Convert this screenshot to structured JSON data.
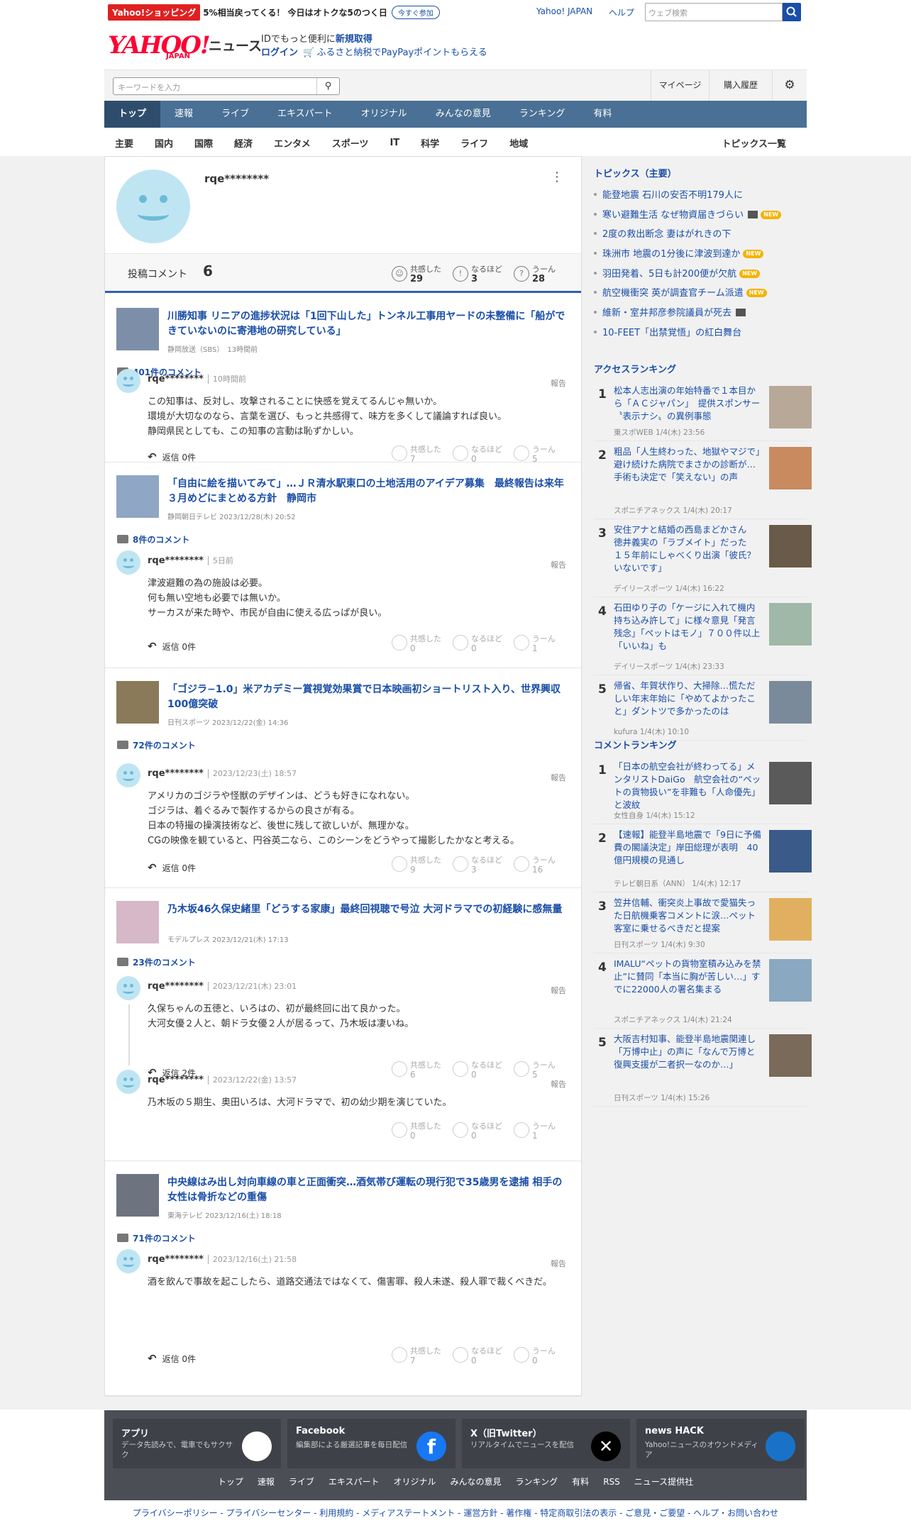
{
  "promo": {
    "shop": "Yahoo!ショッピング",
    "message": "5%相当戻ってくる！ 今日はオトクな5のつく日",
    "button": "今すぐ参加"
  },
  "topbar": {
    "yahoo_japan": "Yahoo! JAPAN",
    "help": "ヘルプ",
    "search_placeholder": "ウェブ検索"
  },
  "header": {
    "logo": "YAHOO!",
    "logo_sub": "JAPAN",
    "service": "ニュース",
    "id_msg": "IDでもっと便利に",
    "signup": "新規取得",
    "login": "ログイン",
    "furusato": "ふるさと納税でPayPayポイントもらえる"
  },
  "search": {
    "placeholder": "キーワードを入力",
    "mypage": "マイページ",
    "history": "購入履歴"
  },
  "nav": [
    "トップ",
    "速報",
    "ライブ",
    "エキスパート",
    "オリジナル",
    "みんなの意見",
    "ランキング",
    "有料"
  ],
  "subnav": [
    "主要",
    "国内",
    "国際",
    "経済",
    "エンタメ",
    "スポーツ",
    "IT",
    "科学",
    "ライフ",
    "地域"
  ],
  "subnav_all": "トピックス一覧",
  "profile": {
    "name": "rqe********",
    "posts_label": "投稿コメント",
    "posts": "6",
    "empathy_label": "共感した",
    "empathy": "29",
    "naruhodo_label": "なるほど",
    "naruhodo": "3",
    "uun_label": "うーん",
    "uun": "28"
  },
  "labels": {
    "report": "報告",
    "empathy": "共感した",
    "naruhodo": "なるほど",
    "uun": "うーん"
  },
  "articles": [
    {
      "title": "川勝知事 リニアの進捗状況は「1回下山した」トンネル工事用ヤードの未整備に「船ができていないのに寄港地の研究している」",
      "source": "静岡放送（SBS）　13時間前",
      "count": "401件のコメント",
      "comments": [
        {
          "user": "rqe********",
          "time": "10時間前",
          "text": [
            "この知事は、反対し、攻撃されることに快感を覚えてるんじゃ無いか。",
            "環境が大切なのなら、言葉を選び、もっと共感得て、味方を多くして議論すれば良い。",
            "静岡県民としても、この知事の言動は恥ずかしい。"
          ],
          "reply": "返信 0件",
          "e": "7",
          "n": "0",
          "u": "5"
        }
      ]
    },
    {
      "title": "「自由に絵を描いてみて」…ＪＲ清水駅東口の土地活用のアイデア募集　最終報告は来年３月めどにまとめる方針　静岡市",
      "source": "静岡朝日テレビ 2023/12/28(木) 20:52",
      "count": "8件のコメント",
      "comments": [
        {
          "user": "rqe********",
          "time": "5日前",
          "text": [
            "津波避難の為の施設は必要。",
            "何も無い空地も必要では無いか。",
            "サーカスが来た時や、市民が自由に使える広っぱが良い。"
          ],
          "reply": "返信 0件",
          "e": "0",
          "n": "0",
          "u": "1"
        }
      ]
    },
    {
      "title": "「ゴジラ−1.0」米アカデミー賞視覚効果賞で日本映画初ショートリスト入り、世界興収100億突破",
      "source": "日刊スポーツ 2023/12/22(金) 14:36",
      "count": "72件のコメント",
      "comments": [
        {
          "user": "rqe********",
          "time": "2023/12/23(土) 18:57",
          "text": [
            "アメリカのゴジラや怪獣のデザインは、どうも好きになれない。",
            "ゴジラは、着ぐるみで製作するからの良さが有る。",
            "日本の特撮の操演技術など、後世に残して欲しいが、無理かな。",
            "CGの映像を観ていると、円谷英二なら、このシーンをどうやって撮影したかなと考える。"
          ],
          "reply": "返信 0件",
          "e": "9",
          "n": "3",
          "u": "16"
        }
      ]
    },
    {
      "title": "乃木坂46久保史緒里「どうする家康」最終回視聴で号泣 大河ドラマでの初経験に感無量",
      "source": "モデルプレス 2023/12/21(木) 17:13",
      "count": "23件のコメント",
      "comments": [
        {
          "user": "rqe********",
          "time": "2023/12/21(木) 23:01",
          "text": [
            "久保ちゃんの五徳と、いろはの、初が最終回に出て良かった。",
            "大河女優２人と、朝ドラ女優２人が居るって、乃木坂は凄いね。"
          ],
          "reply": "返信 2件",
          "e": "6",
          "n": "0",
          "u": "5"
        },
        {
          "user": "rqe********",
          "time": "2023/12/22(金) 13:57",
          "text": [
            "乃木坂の５期生、奥田いろは、大河ドラマで、初の幼少期を演じていた。"
          ],
          "reply": "",
          "e": "0",
          "n": "0",
          "u": "1"
        }
      ]
    },
    {
      "title": "中央線はみ出し対向車線の車と正面衝突…酒気帯び運転の現行犯で35歳男を逮捕 相手の女性は骨折などの重傷",
      "source": "東海テレビ 2023/12/16(土) 18:18",
      "count": "71件のコメント",
      "comments": [
        {
          "user": "rqe********",
          "time": "2023/12/16(土) 21:58",
          "text": [
            "酒を飲んで事故を起こしたら、道路交通法ではなくて、傷害罪、殺人未遂、殺人罪で裁くべきだ。"
          ],
          "reply": "返信 0件",
          "e": "7",
          "n": "0",
          "u": "0"
        }
      ]
    }
  ],
  "topics": {
    "title": "トピックス（主要）",
    "items": [
      {
        "text": "能登地震 石川の安否不明179人に",
        "video": false,
        "new": false
      },
      {
        "text": "寒い避難生活 なぜ物資届きづらい",
        "video": true,
        "new": true
      },
      {
        "text": "2度の救出断念 妻はがれきの下",
        "video": false,
        "new": false
      },
      {
        "text": "珠洲市 地震の1分後に津波到達か",
        "video": false,
        "new": true
      },
      {
        "text": "羽田発着、5日も計200便が欠航",
        "video": false,
        "new": true
      },
      {
        "text": "航空機衝突 英が調査官チーム派遣",
        "video": false,
        "new": true
      },
      {
        "text": "維新・室井邦彦参院議員が死去",
        "video": true,
        "new": false
      },
      {
        "text": "10-FEET「出禁覚悟」の紅白舞台",
        "video": false,
        "new": false
      }
    ],
    "new_label": "NEW"
  },
  "access_ranking": {
    "title": "アクセスランキング",
    "items": [
      {
        "title": "松本人志出演の年始特番で１本目から「ＡＣジャパン」　提供スポンサー〝表示ナシ〟の異例事態",
        "source": "東スポWEB 1/4(木) 23:56"
      },
      {
        "title": "粗品「人生終わった、地獄やマジで」避け続けた病院でまさかの診断が…手術も決定で「笑えない」の声",
        "source": "スポニチアネックス 1/4(木) 20:17"
      },
      {
        "title": "安住アナと結婚の西島まどかさん　徳井義実の「ラブメイト」だった　１５年前にしゃべくり出演「彼氏？いないです」",
        "source": "デイリースポーツ 1/4(木) 16:22"
      },
      {
        "title": "石田ゆり子の「ケージに入れて機内持ち込み許して」に様々意見「発言残念」「ペットはモノ」７００件以上「いいね」も",
        "source": "デイリースポーツ 1/4(木) 23:33"
      },
      {
        "title": "帰省、年賀状作り、大掃除…慌ただしい年末年始に「やめてよかったこと」ダントツで多かったのは",
        "source": "kufura 1/4(木) 10:10"
      }
    ]
  },
  "comment_ranking": {
    "title": "コメントランキング",
    "items": [
      {
        "title": "「日本の航空会社が終わってる」メンタリストDaiGo　航空会社の“ペットの貨物扱い”を非難も「人命優先」と波紋",
        "source": "女性自身 1/4(木) 15:12"
      },
      {
        "title": "【速報】能登半島地震で「9日に予備費の閣議決定」岸田総理が表明　40億円規模の見通し",
        "source": "テレビ朝日系（ANN） 1/4(木) 12:17"
      },
      {
        "title": "笠井信輔、衝突炎上事故で愛猫失った日航機乗客コメントに涙…ペット客室に乗せるべきだと提案",
        "source": "日刊スポーツ 1/4(木) 9:30"
      },
      {
        "title": "IMALU“ペットの貨物室積み込みを禁止”に賛同「本当に胸が苦しい…」すでに22000人の署名集まる",
        "source": "スポニチアネックス 1/4(木) 21:24"
      },
      {
        "title": "大阪吉村知事、能登半島地震関連し「万博中止」の声に「なんで万博と復興支援が二者択一なのか…」",
        "source": "日刊スポーツ 1/4(木) 15:26"
      }
    ]
  },
  "footer": {
    "boxes": [
      {
        "title": "アプリ",
        "desc": "データ先読みで、電車でもサクサク"
      },
      {
        "title": "Facebook",
        "desc": "編集部による厳選記事を毎日配信"
      },
      {
        "title": "X（旧Twitter）",
        "desc": "リアルタイムでニュースを配信"
      },
      {
        "title": "news HACK",
        "desc": "Yahoo!ニュースのオウンドメディア"
      }
    ],
    "links": [
      "トップ",
      "速報",
      "ライブ",
      "エキスパート",
      "オリジナル",
      "みんなの意見",
      "ランキング",
      "有料",
      "RSS",
      "ニュース提供社"
    ],
    "legal": "プライバシーポリシー - プライバシーセンター - 利用規約 - メディアステートメント - 運営方針 - 著作権 - 特定商取引法の表示 - ご意見・ご要望 - ヘルプ・お問い合わせ"
  },
  "colors": {
    "accent": "#1a4ea8",
    "nav": "#4a7095",
    "red": "#ff0033"
  }
}
